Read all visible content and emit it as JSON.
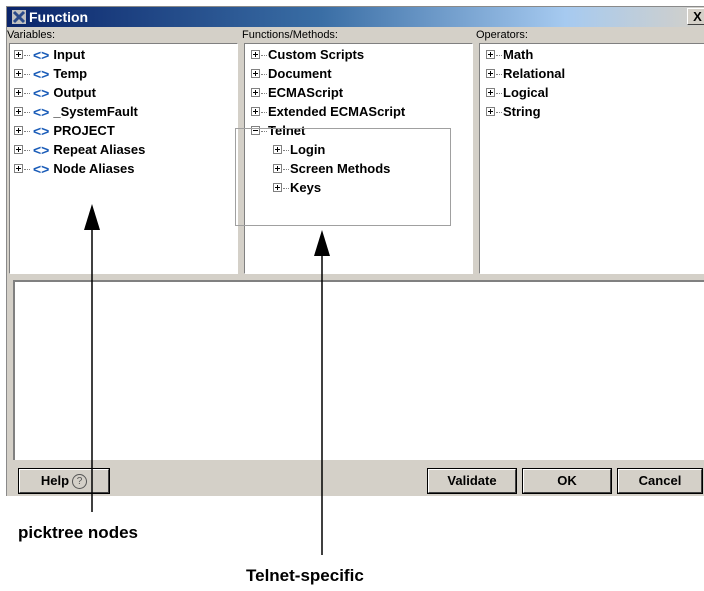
{
  "window": {
    "title": "Function",
    "close_label": "X"
  },
  "columns": {
    "variables": "Variables:",
    "functions": "Functions/Methods:",
    "operators": "Operators:"
  },
  "variables": [
    "Input",
    "Temp",
    "Output",
    "_SystemFault",
    "PROJECT",
    "Repeat Aliases",
    "Node Aliases"
  ],
  "functions": {
    "top": [
      "Custom Scripts",
      "Document",
      "ECMAScript",
      "Extended ECMAScript"
    ],
    "telnet": "Telnet",
    "telnet_children": [
      "Login",
      "Screen Methods",
      "Keys"
    ]
  },
  "operators": [
    "Math",
    "Relational",
    "Logical",
    "String"
  ],
  "buttons": {
    "help": "Help",
    "help_icon": "?",
    "validate": "Validate",
    "ok": "OK",
    "cancel": "Cancel"
  },
  "annotations": {
    "picktree": "picktree nodes",
    "telnet": "Telnet-specific"
  },
  "colors": {
    "title_bar": "#0a246a",
    "variable_icon": "#1a5cb8"
  }
}
